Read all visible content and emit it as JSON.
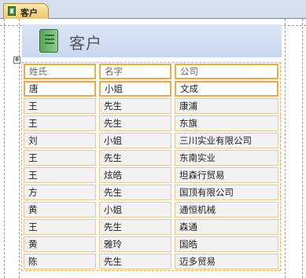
{
  "tab": {
    "label": "客户"
  },
  "form": {
    "title": "客户"
  },
  "layout_handle": {
    "symbol": "✥"
  },
  "table": {
    "columns": [
      "姓氏",
      "名字",
      "公司"
    ],
    "rows": [
      [
        "唐",
        "小姐",
        "文成"
      ],
      [
        "王",
        "先生",
        "康浦"
      ],
      [
        "王",
        "先生",
        "东旗"
      ],
      [
        "刘",
        "小姐",
        "三川实业有限公司"
      ],
      [
        "王",
        "先生",
        "东南实业"
      ],
      [
        "王",
        "炫皓",
        "坦森行贸易"
      ],
      [
        "方",
        "先生",
        "国顶有限公司"
      ],
      [
        "黄",
        "小姐",
        "通恒机械"
      ],
      [
        "王",
        "先生",
        "森通"
      ],
      [
        "黄",
        "雅玲",
        "国皓"
      ],
      [
        "陈",
        "先生",
        "迈多贸易"
      ]
    ]
  }
}
